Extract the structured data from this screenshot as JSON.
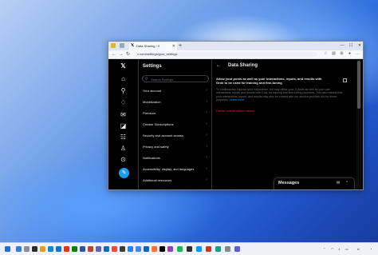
{
  "browser": {
    "tab_title": "Data Sharing / X",
    "url": "x.com/settings/grok_settings"
  },
  "settings": {
    "title": "Settings",
    "search_placeholder": "Search Settings",
    "menu": [
      "Your account",
      "Monetization",
      "Premium",
      "Creator Subscriptions",
      "Security and account access",
      "Privacy and safety",
      "Notifications",
      "Accessibility, display, and languages",
      "Additional resources"
    ]
  },
  "detail": {
    "title": "Data Sharing",
    "allow_text": "Allow your posts as well as your interactions, inputs, and results with Grok to be used for training and fine-tuning",
    "description": "To continuously improve your experience, we may utilize your X posts as well as your user interactions, inputs and results with Grok for training and fine-tuning purposes. This also means that your interactions, inputs, and results may also be shared with our service provider xAI for these purposes.",
    "learn_more": "Learn more",
    "delete_link": "Delete conversation history",
    "checked": false
  },
  "messages": {
    "title": "Messages"
  },
  "icons": {
    "rail": [
      "x-logo-icon",
      "home-icon",
      "search-icon",
      "notifications-icon",
      "messages-icon",
      "grok-icon",
      "communities-icon",
      "profile-icon",
      "more-icon"
    ],
    "accent": "#1d9bf0",
    "danger": "#f4212e"
  }
}
